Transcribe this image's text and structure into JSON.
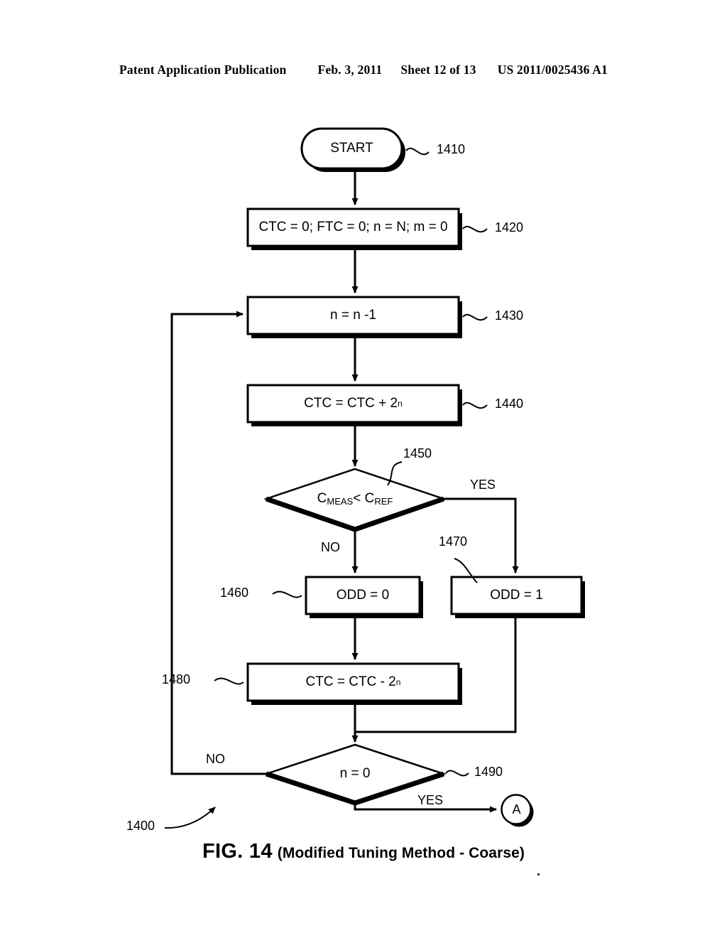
{
  "header": {
    "publication": "Patent Application Publication",
    "date": "Feb. 3, 2011",
    "sheet": "Sheet 12 of 13",
    "patent_number": "US 2011/0025436 A1"
  },
  "figure": {
    "number": "FIG. 14",
    "description": "(Modified Tuning Method - Coarse)",
    "diagram_ref": "1400"
  },
  "nodes": {
    "start": {
      "label": "START",
      "ref": "1410",
      "shape": "terminator"
    },
    "init": {
      "label": "CTC = 0; FTC = 0; n = N; m = 0",
      "ref": "1420",
      "shape": "process"
    },
    "decrement": {
      "label": "n = n -1",
      "ref": "1430",
      "shape": "process"
    },
    "ctc_add": {
      "label_pre": "CTC = CTC + 2",
      "label_sup": "n",
      "ref": "1440",
      "shape": "process"
    },
    "compare": {
      "label_pre": "C",
      "label_sub1": "MEAS",
      "label_mid": " < C",
      "label_sub2": "REF",
      "ref": "1450",
      "shape": "decision"
    },
    "odd_zero": {
      "label": "ODD = 0",
      "ref": "1460",
      "shape": "process"
    },
    "odd_one": {
      "label": "ODD = 1",
      "ref": "1470",
      "shape": "process"
    },
    "ctc_sub": {
      "label_pre": "CTC = CTC - 2",
      "label_sup": "n",
      "ref": "1480",
      "shape": "process"
    },
    "n_zero": {
      "label": "n = 0",
      "ref": "1490",
      "shape": "decision"
    },
    "connector_a": {
      "label": "A",
      "shape": "connector"
    }
  },
  "branches": {
    "compare_yes": "YES",
    "compare_no": "NO",
    "n_zero_no": "NO",
    "n_zero_yes": "YES"
  },
  "colors": {
    "stroke": "#000000",
    "fill": "#ffffff",
    "shadow": "#000000",
    "background": "#ffffff"
  }
}
